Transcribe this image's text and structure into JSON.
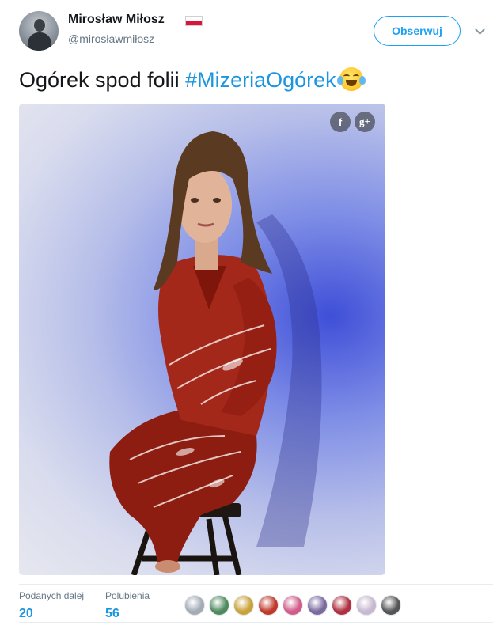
{
  "author": {
    "name": "Mirosław Miłosz",
    "handle": "@mirosławmiłosz",
    "flag": "poland-flag-icon",
    "avatar": "avatar-user"
  },
  "actions": {
    "follow_label": "Obserwuj",
    "more_icon": "chevron-down-icon"
  },
  "tweet": {
    "text": "Ogórek spod folii ",
    "hashtag": "#MizeriaOgórek",
    "emoji": "face-with-tears-of-joy-icon"
  },
  "media": {
    "share_facebook": "f",
    "share_google": "g+"
  },
  "stats": {
    "retweets_label": "Podanych dalej",
    "retweets_count": "20",
    "likes_label": "Polubienia",
    "likes_count": "56"
  },
  "likers_colors": [
    "#a3abb5",
    "#4f8a5e",
    "#c9a23a",
    "#c0392b",
    "#d15b8a",
    "#7b6a9e",
    "#b03040",
    "#c8b8d0",
    "#555555"
  ],
  "colors": {
    "accent": "#1da1f2",
    "link": "#1b95e0",
    "muted": "#657786"
  }
}
